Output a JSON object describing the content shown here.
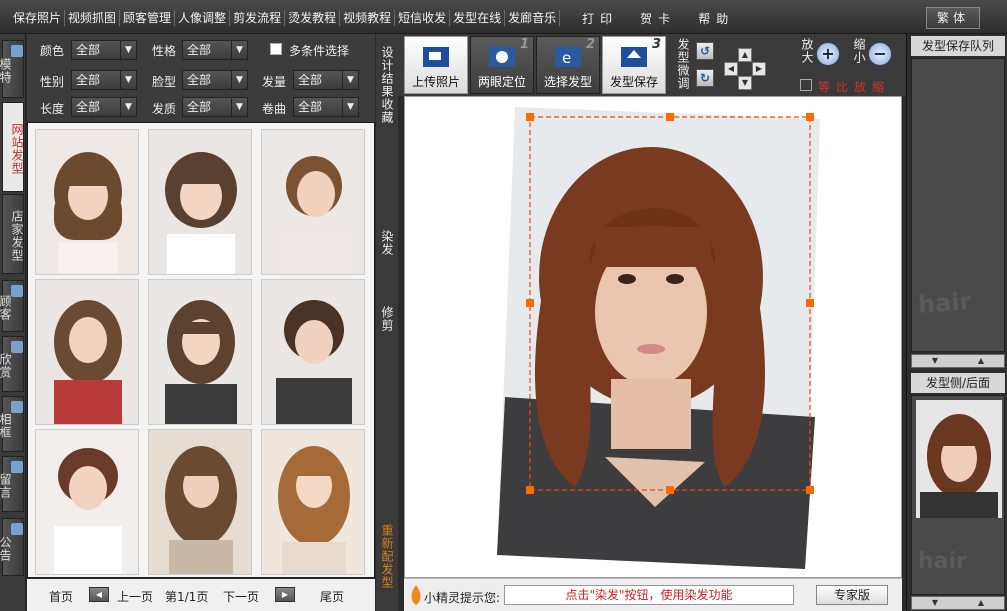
{
  "menu": {
    "items": [
      "保存照片",
      "视频抓图",
      "顾客管理",
      "人像调整",
      "剪发流程",
      "烫发教程",
      "视频教程",
      "短信收发",
      "发型在线",
      "发廊音乐"
    ],
    "extra": [
      "打印",
      "贺卡",
      "帮助"
    ],
    "traditional_label": "繁体"
  },
  "side_tabs": [
    "模特",
    "网站发型",
    "店家发型",
    "顾客",
    "欣赏",
    "相框",
    "留言",
    "公告"
  ],
  "filters": {
    "color_label": "颜色",
    "color_value": "全部",
    "personality_label": "性格",
    "personality_value": "全部",
    "multi_label": "多条件选择",
    "gender_label": "性别",
    "gender_value": "全部",
    "face_label": "脸型",
    "face_value": "全部",
    "volume_label": "发量",
    "volume_value": "全部",
    "length_label": "长度",
    "length_value": "全部",
    "texture_label": "发质",
    "texture_value": "全部",
    "curl_label": "卷曲",
    "curl_value": "全部"
  },
  "pager": {
    "first": "首页",
    "prev": "上一页",
    "page_info": "第1/1页",
    "next": "下一页",
    "last": "尾页"
  },
  "strip": {
    "save_result": "设计结果收藏",
    "dye": "染发",
    "trim": "修剪",
    "redo": "重新配发型"
  },
  "toolbar": {
    "upload": "上传照片",
    "eye_pos": "两眼定位",
    "select_style": "选择发型",
    "save_style": "发型保存",
    "fine_tune": "发型微调",
    "zoom_in": "放大",
    "zoom_out": "缩小",
    "ratio": "等比放缩",
    "step1": "1",
    "step2": "2",
    "step3": "3"
  },
  "hint": {
    "label": "小精灵提示您:",
    "message": "点击\"染发\"按钮，使用染发功能",
    "expert": "专家版"
  },
  "right": {
    "queue_title": "发型保存队列",
    "side_back_title": "发型侧/后面",
    "watermark": "hair"
  },
  "colors": {
    "accent_red": "#c03030",
    "hint_red": "#d02020",
    "handle_orange": "#ff6a00"
  }
}
